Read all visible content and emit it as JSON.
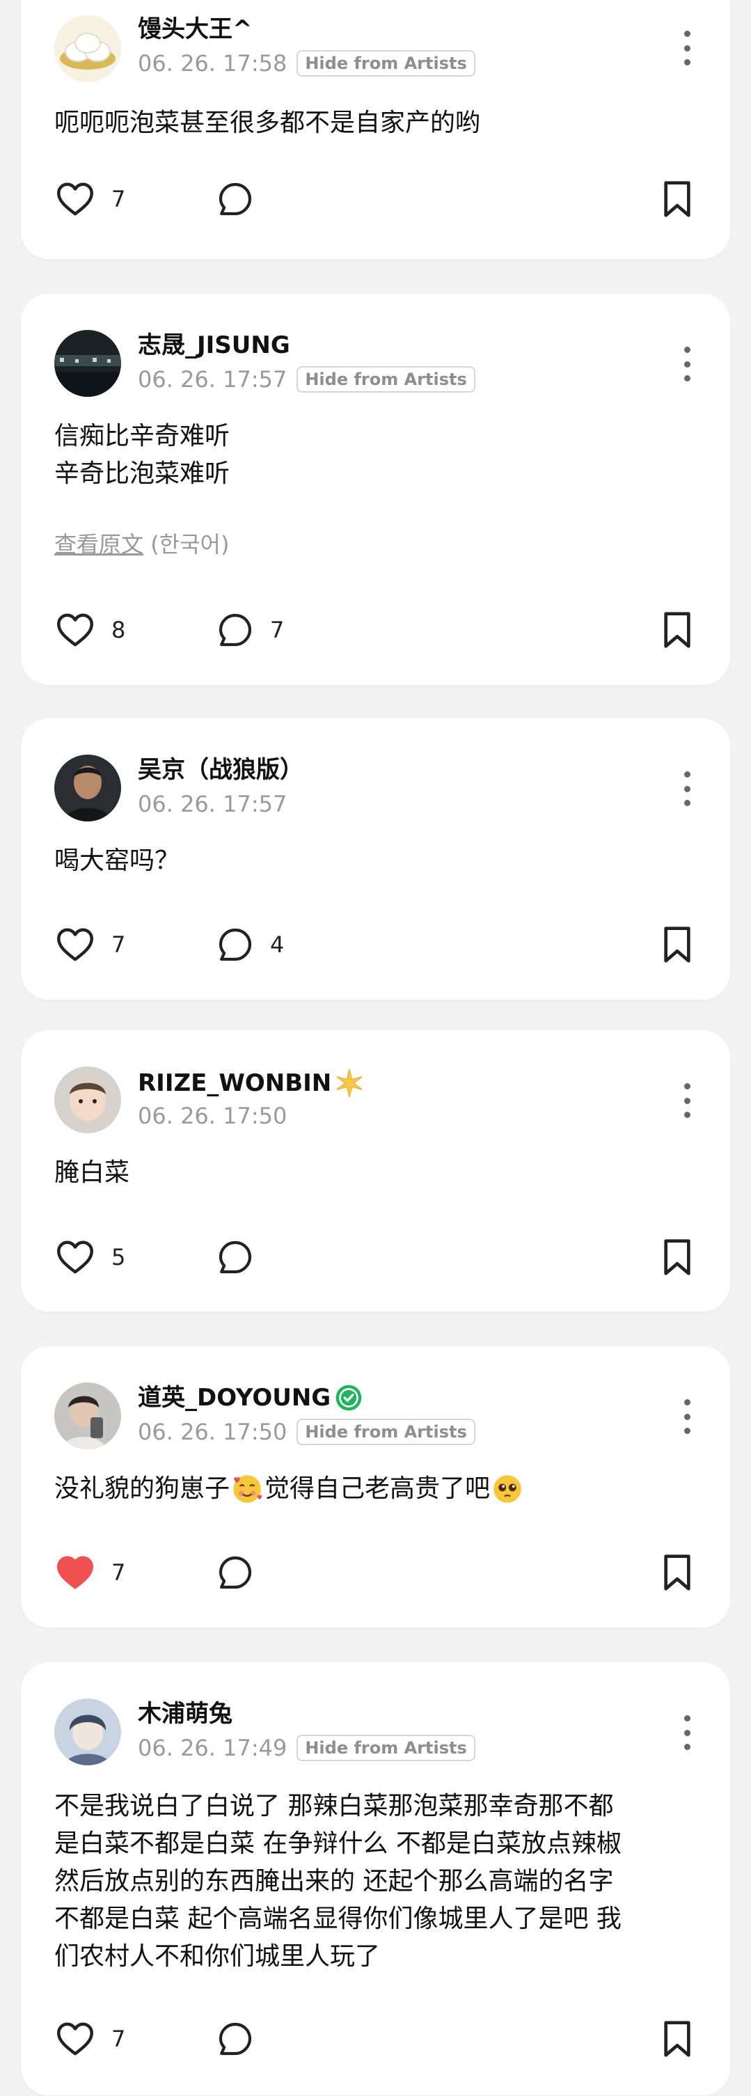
{
  "hide_label": "Hide from Artists",
  "translate": {
    "link": "查看原文",
    "lang": " (한국어)"
  },
  "posts": [
    {
      "name": "馒头大王^",
      "time": "06. 26. 17:58",
      "lines": [
        "呃呃呃泡菜甚至很多都不是自家产的哟"
      ],
      "likes": "7",
      "comments": ""
    },
    {
      "name": "志晟_JISUNG",
      "time": "06. 26. 17:57",
      "lines": [
        "信痴比辛奇难听",
        "辛奇比泡菜难听"
      ],
      "likes": "8",
      "comments": "7"
    },
    {
      "name": "吴京（战狼版）",
      "time": "06. 26. 17:57",
      "lines": [
        "喝大窑吗？"
      ],
      "likes": "7",
      "comments": "4"
    },
    {
      "name": "RIIZE_WONBIN",
      "time": "06. 26. 17:50",
      "lines": [
        "腌白菜"
      ],
      "likes": "5",
      "comments": ""
    },
    {
      "name": "道英_DOYOUNG",
      "time": "06. 26. 17:50",
      "lines": [
        "没礼貌的狗崽子",
        "觉得自己老高贵了吧"
      ],
      "likes": "7",
      "comments": ""
    },
    {
      "name": "木浦萌兔",
      "time": "06. 26. 17:49",
      "lines": [
        "不是我说白了白说了 那辣白菜那泡菜那幸奇那不都",
        "是白菜不都是白菜 在争辩什么 不都是白菜放点辣椒",
        "然后放点别的东西腌出来的 还起个那么高端的名字",
        "不都是白菜 起个高端名显得你们像城里人了是吧 我",
        "们农村人不和你们城里人玩了"
      ],
      "likes": "7",
      "comments": ""
    }
  ],
  "colors": {
    "liked": "#f05050",
    "verified": "#1fb55c",
    "name": "#111111",
    "meta": "#9a9a9a"
  }
}
